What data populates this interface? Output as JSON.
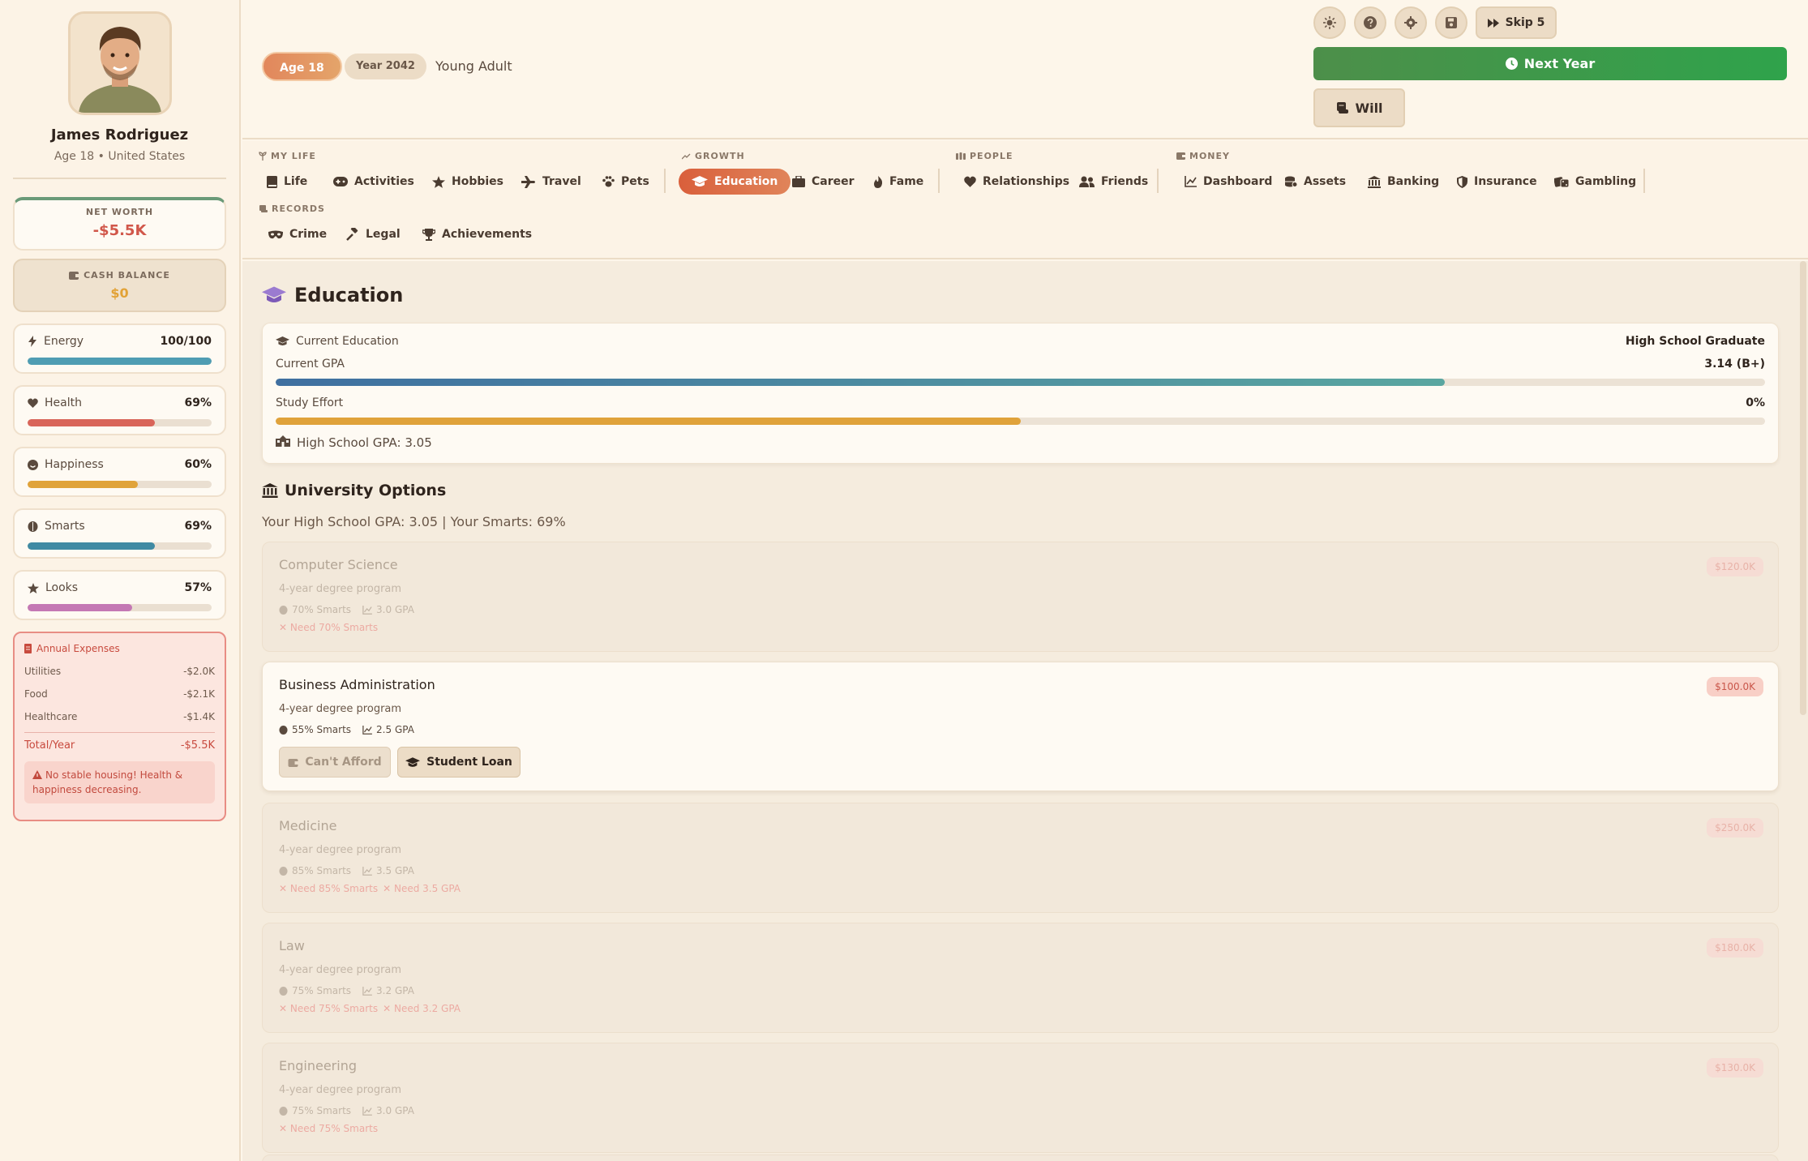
{
  "profile": {
    "name": "James Rodriguez",
    "subtitle": "Age 18 • United States"
  },
  "net_worth": {
    "label": "NET WORTH",
    "value": "-$5.5K"
  },
  "cash": {
    "label": "CASH BALANCE",
    "value": "$0"
  },
  "stats": [
    {
      "label": "Energy",
      "value": "100/100",
      "fraction": 1.0,
      "color": "#4f9db3"
    },
    {
      "label": "Health",
      "value": "69%",
      "fraction": 0.69,
      "color": "#d9655a"
    },
    {
      "label": "Happiness",
      "value": "60%",
      "fraction": 0.6,
      "color": "#e0a33a"
    },
    {
      "label": "Smarts",
      "value": "69%",
      "fraction": 0.69,
      "color": "#3f8aa3"
    },
    {
      "label": "Looks",
      "value": "57%",
      "fraction": 0.57,
      "color": "#c478b4"
    }
  ],
  "expenses": {
    "title": "Annual Expenses",
    "rows": [
      {
        "label": "Utilities",
        "value": "-$2.0K"
      },
      {
        "label": "Food",
        "value": "-$2.1K"
      },
      {
        "label": "Healthcare",
        "value": "-$1.4K"
      }
    ],
    "total_label": "Total/Year",
    "total_value": "-$5.5K",
    "warning": "No stable housing! Health & happiness decreasing."
  },
  "header": {
    "age": "Age 18",
    "year": "Year 2042",
    "stage": "Young Adult",
    "skip_label": "Skip 5",
    "next_label": "Next Year",
    "will_label": "Will"
  },
  "nav": {
    "groups": {
      "my_life": "MY LIFE",
      "growth": "GROWTH",
      "people": "PEOPLE",
      "money": "MONEY",
      "records": "RECORDS"
    },
    "items": {
      "life": "Life",
      "activities": "Activities",
      "hobbies": "Hobbies",
      "travel": "Travel",
      "pets": "Pets",
      "education": "Education",
      "career": "Career",
      "fame": "Fame",
      "relationships": "Relationships",
      "friends": "Friends",
      "dashboard": "Dashboard",
      "assets": "Assets",
      "banking": "Banking",
      "insurance": "Insurance",
      "gambling": "Gambling",
      "crime": "Crime",
      "legal": "Legal",
      "achievements": "Achievements"
    }
  },
  "education": {
    "title": "Education",
    "current_label": "Current Education",
    "current_value": "High School Graduate",
    "gpa_label": "Current GPA",
    "gpa_value": "3.14 (B+)",
    "gpa_fraction": 0.785,
    "effort_label": "Study Effort",
    "effort_value": "0%",
    "effort_fill_fraction": 0.5,
    "hs_gpa": "High School GPA: 3.05"
  },
  "university": {
    "title": "University Options",
    "subtitle": "Your High School GPA: 3.05 | Your Smarts: 69%",
    "options": [
      {
        "name": "Computer Science",
        "desc": "4-year degree program",
        "smarts": "70% Smarts",
        "gpa": "3.0 GPA",
        "price": "$120.0K",
        "needs": [
          "Need 70% Smarts"
        ]
      },
      {
        "name": "Business Administration",
        "desc": "4-year degree program",
        "smarts": "55% Smarts",
        "gpa": "2.5 GPA",
        "price": "$100.0K",
        "cant_afford": "Can't Afford",
        "loan": "Student Loan"
      },
      {
        "name": "Medicine",
        "desc": "4-year degree program",
        "smarts": "85% Smarts",
        "gpa": "3.5 GPA",
        "price": "$250.0K",
        "needs": [
          "Need 85% Smarts",
          "Need 3.5 GPA"
        ]
      },
      {
        "name": "Law",
        "desc": "4-year degree program",
        "smarts": "75% Smarts",
        "gpa": "3.2 GPA",
        "price": "$180.0K",
        "needs": [
          "Need 75% Smarts",
          "Need 3.2 GPA"
        ]
      },
      {
        "name": "Engineering",
        "desc": "4-year degree program",
        "smarts": "75% Smarts",
        "gpa": "3.0 GPA",
        "price": "$130.0K",
        "needs": [
          "Need 75% Smarts"
        ]
      }
    ]
  }
}
